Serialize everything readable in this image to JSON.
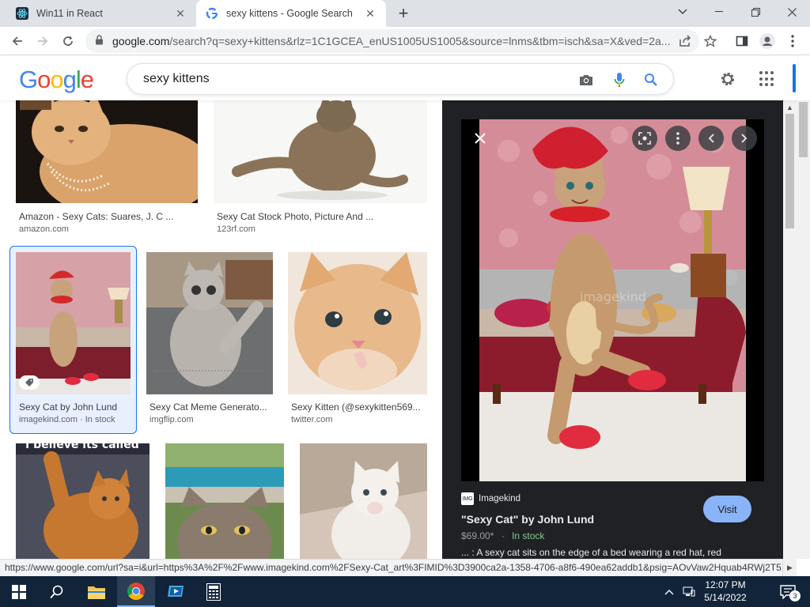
{
  "tabs": [
    {
      "title": "Win11 in React",
      "icon": "react-favicon"
    },
    {
      "title": "sexy kittens - Google Search",
      "icon": "google-favicon"
    }
  ],
  "window_controls": {
    "minimize": "—",
    "restore": "❐",
    "close": "✕",
    "dropdown": "⌄"
  },
  "address": {
    "url_host": "google.com",
    "url_rest": "/search?q=sexy+kittens&rlz=1C1GCEA_enUS1005US1005&source=lnms&tbm=isch&sa=X&ved=2a..."
  },
  "search": {
    "query": "sexy kittens",
    "logo": "Google"
  },
  "results": [
    {
      "title": "Amazon - Sexy Cats: Suares, J. C ...",
      "source": "amazon.com"
    },
    {
      "title": "Sexy Cat Stock Photo, Picture And ...",
      "source": "123rf.com"
    },
    {
      "title": "Sexy Cat by John Lund",
      "source": "imagekind.com · In stock"
    },
    {
      "title": "Sexy Cat Meme Generato...",
      "source": "imgflip.com"
    },
    {
      "title": "Sexy Kitten (@sexykitten569...",
      "source": "twitter.com"
    },
    {
      "title": "I believe its called",
      "source": ""
    }
  ],
  "preview": {
    "site": "Imagekind",
    "site_icon_text": "IMG",
    "title": "\"Sexy Cat\" by John Lund",
    "price": "$69.00*",
    "separator": "·",
    "stock": "In stock",
    "description": "... : A sexy cat sits on the edge of a bed wearing a red hat, red",
    "visit": "Visit"
  },
  "status_url": "https://www.google.com/url?sa=i&url=https%3A%2F%2Fwww.imagekind.com%2FSexy-Cat_art%3FIMID%3D3900ca2a-1358-4706-a8f6-490ea62addb1&psig=AOvVaw2Hquab4RWj2T5...",
  "taskbar": {
    "time": "12:07 PM",
    "date": "5/14/2022",
    "notifications": "3"
  }
}
